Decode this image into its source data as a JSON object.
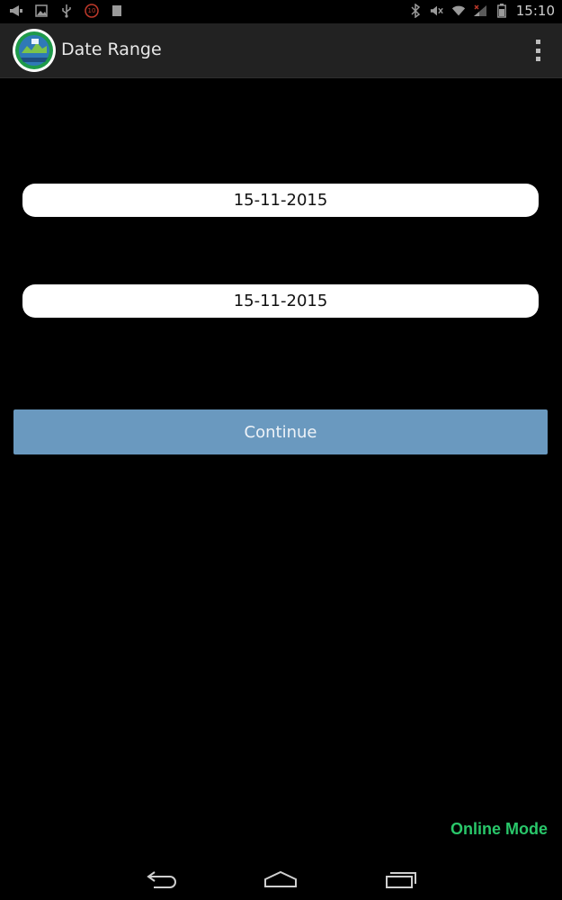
{
  "status_bar": {
    "time": "15:10",
    "left_icons": [
      "megaphone-icon",
      "image-icon",
      "usb-icon",
      "notification-10-icon",
      "storage-icon"
    ],
    "right_icons": [
      "bluetooth-icon",
      "mute-icon",
      "wifi-icon",
      "signal-icon",
      "battery-icon"
    ],
    "badge_count": "10"
  },
  "action_bar": {
    "title": "Date Range",
    "logo_icon": "app-logo-icon",
    "menu_icon": "overflow-menu-icon"
  },
  "form": {
    "start_date": "15-11-2015",
    "end_date": "15-11-2015",
    "continue_label": "Continue"
  },
  "footer": {
    "mode_label": "Online Mode"
  },
  "nav_bar": {
    "icons": [
      "back-icon",
      "home-icon",
      "recents-icon"
    ]
  },
  "colors": {
    "background": "#000000",
    "action_bar": "#222222",
    "button": "#6a99bf",
    "online_mode": "#29c76a",
    "field": "#ffffff"
  }
}
